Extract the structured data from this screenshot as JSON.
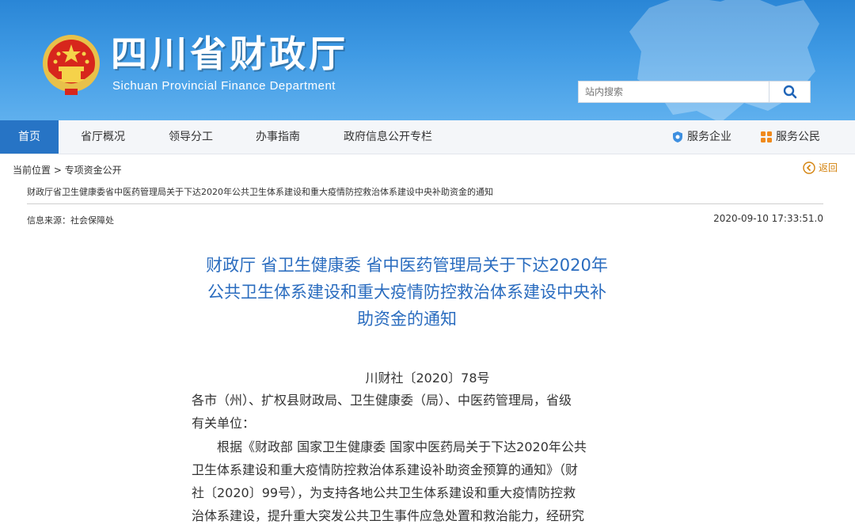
{
  "header": {
    "title": "四川省财政厅",
    "subtitle": "Sichuan Provincial Finance Department",
    "search": {
      "placeholder": "站内搜索",
      "value": "站内搜索"
    }
  },
  "nav": {
    "items": [
      "首页",
      "省厅概况",
      "领导分工",
      "办事指南",
      "政府信息公开专栏"
    ],
    "active_index": 0,
    "right_items": [
      {
        "icon": "shield-icon",
        "label": "服务企业"
      },
      {
        "icon": "grid-icon",
        "label": "服务公民"
      }
    ]
  },
  "breadcrumb": {
    "text": "当前位置 > 专项资金公开",
    "back_label": "返回",
    "doc_link": "财政厅省卫生健康委省中医药管理局关于下达2020年公共卫生体系建设和重大疫情防控救治体系建设中央补助资金的通知"
  },
  "meta": {
    "source": "信息来源：社会保障处",
    "datetime": "2020-09-10 17:33:51.0"
  },
  "article": {
    "title_lines": [
      "财政厅 省卫生健康委 省中医药管理局关于下达2020年",
      "公共卫生体系建设和重大疫情防控救治体系建设中央补",
      "助资金的通知"
    ],
    "doc_number": "川财社〔2020〕78号",
    "body_lines": [
      "各市（州）、扩权县财政局、卫生健康委（局）、中医药管理局，省级",
      "有关单位：",
      "　　根据《财政部 国家卫生健康委 国家中医药局关于下达2020年公共",
      "卫生体系建设和重大疫情防控救治体系建设补助资金预算的通知》（财",
      "社〔2020〕99号），为支持各地公共卫生体系建设和重大疫情防控救",
      "治体系建设，提升重大突发公共卫生事件应急处置和救治能力，经研究"
    ]
  },
  "colors": {
    "header_blue": "#3f9ae4",
    "nav_active": "#2774c5",
    "title_blue": "#2a6cbf",
    "back_orange": "#d4830e"
  }
}
